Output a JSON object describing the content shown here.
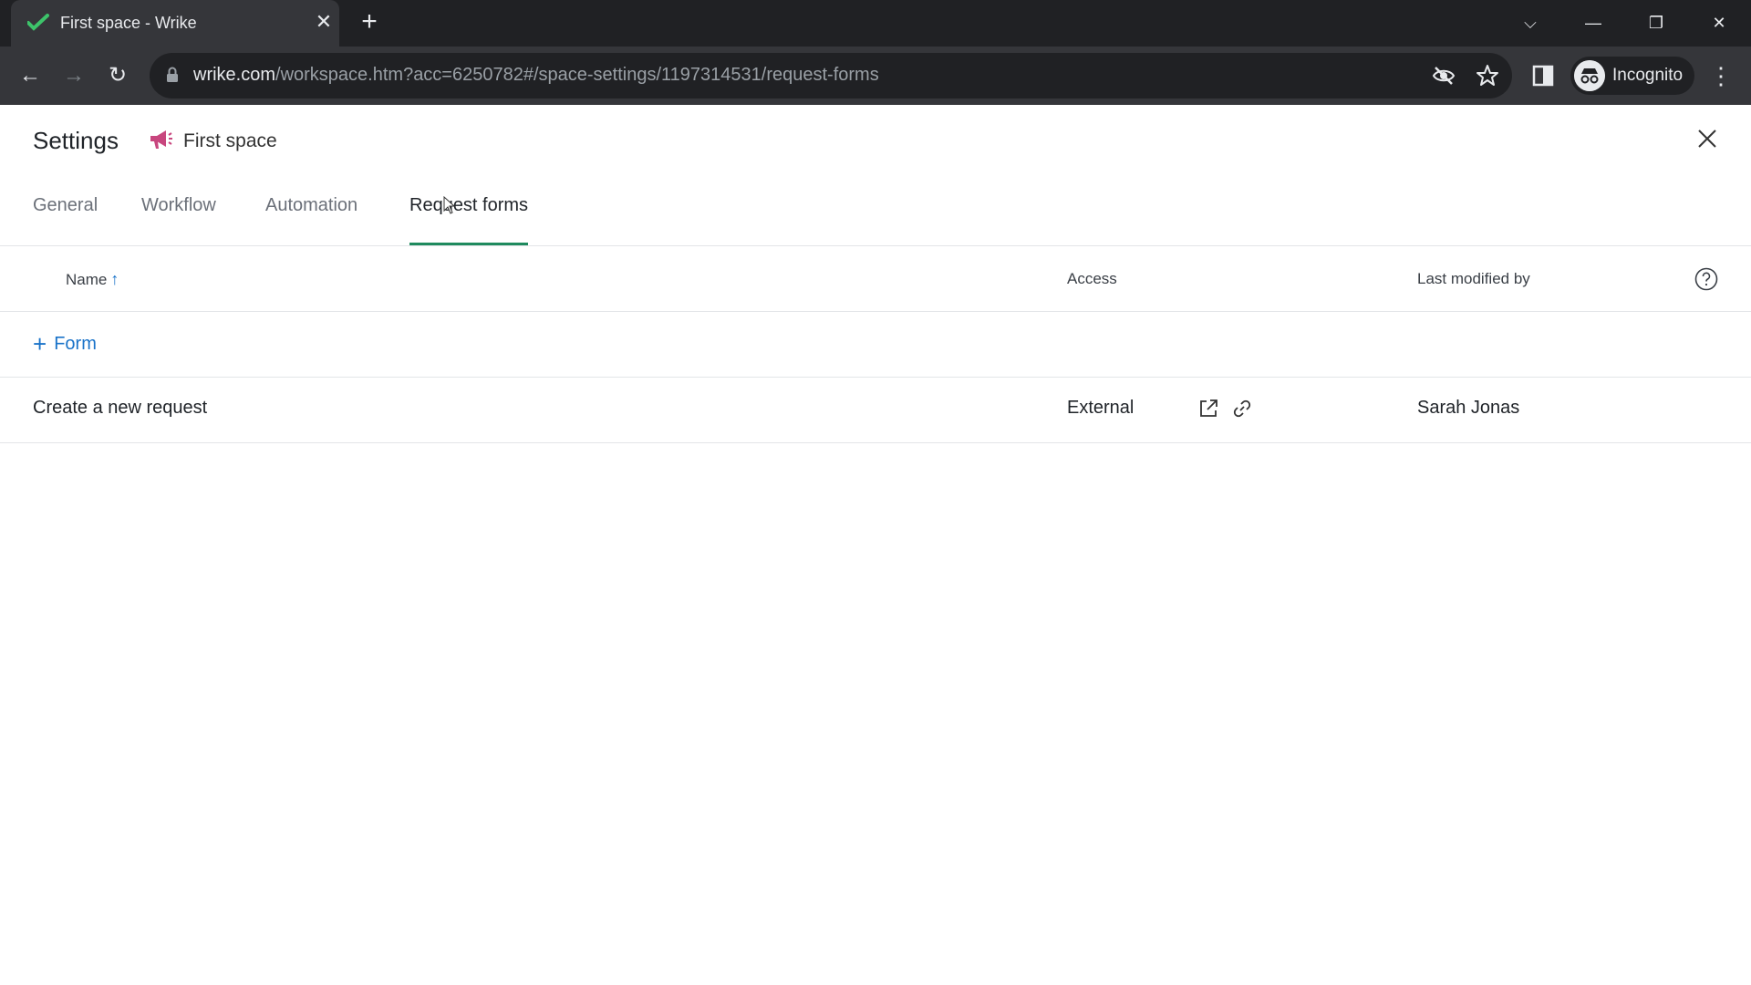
{
  "browser": {
    "tab_title": "First space - Wrike",
    "tab_close": "✕",
    "new_tab": "+",
    "url_host": "wrike.com",
    "url_path": "/workspace.htm?acc=6250782#/space-settings/1197314531/request-forms",
    "profile_label": "Incognito",
    "window_controls": {
      "minimize": "—",
      "restore": "❐",
      "close": "✕",
      "tab_search": "⌵"
    },
    "nav": {
      "back": "←",
      "forward": "→",
      "reload": "↻",
      "menu": "⋮"
    }
  },
  "settings": {
    "title": "Settings",
    "space_name": "First space",
    "space_icon": "megaphone-icon",
    "accent_color": "#1f8a5e",
    "tabs": [
      {
        "label": "General"
      },
      {
        "label": "Workflow"
      },
      {
        "label": "Automation"
      },
      {
        "label": "Request forms",
        "active": true
      }
    ]
  },
  "table": {
    "columns": {
      "name": "Name",
      "sort_arrow": "↑",
      "access": "Access",
      "last_modified_by": "Last modified by"
    },
    "add_form_label": "Form",
    "add_form_plus": "+",
    "rows": [
      {
        "name": "Create a new request",
        "access": "External",
        "last_modified_by": "Sarah Jonas"
      }
    ]
  }
}
